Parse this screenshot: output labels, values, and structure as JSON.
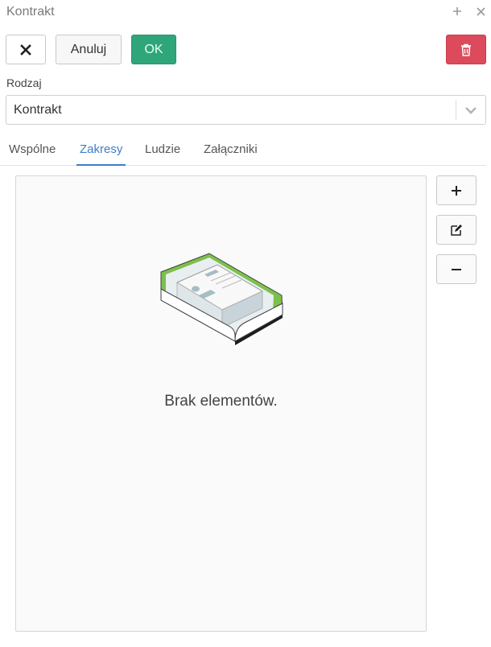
{
  "window": {
    "title": "Kontrakt",
    "icons": {
      "pin": "plus-icon",
      "close": "close-icon"
    }
  },
  "toolbar": {
    "close_icon": "x-icon",
    "cancel_label": "Anuluj",
    "ok_label": "OK",
    "delete_icon": "trash-icon"
  },
  "form": {
    "rodzaj_label": "Rodzaj",
    "rodzaj_value": "Kontrakt",
    "dropdown_icon": "chevron-down-icon"
  },
  "tabs": [
    {
      "label": "Wspólne",
      "active": false
    },
    {
      "label": "Zakresy",
      "active": true
    },
    {
      "label": "Ludzie",
      "active": false
    },
    {
      "label": "Załączniki",
      "active": false
    }
  ],
  "content": {
    "empty_message": "Brak elementów.",
    "illustration": "empty-box-illustration"
  },
  "side_actions": {
    "add_icon": "plus-icon",
    "edit_icon": "edit-icon",
    "remove_icon": "minus-icon"
  },
  "colors": {
    "ok": "#2fa57a",
    "delete": "#dc4a5c",
    "active_tab": "#3d7ec8",
    "illustration_green": "#7cc04b"
  }
}
